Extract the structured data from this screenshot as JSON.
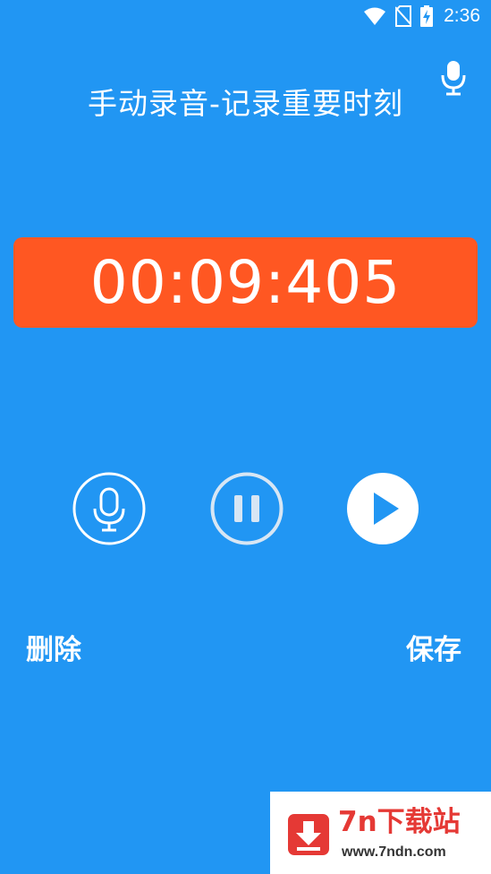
{
  "status_bar": {
    "time": "2:36",
    "icons": [
      "wifi-icon",
      "no-sim-icon",
      "battery-charging-icon"
    ]
  },
  "header": {
    "title": "手动录音-记录重要时刻",
    "icon": "microphone-icon"
  },
  "timer": {
    "value": "00:09:405",
    "color": "#FF5722"
  },
  "controls": {
    "record_icon": "microphone-icon",
    "pause_icon": "pause-icon",
    "play_icon": "play-icon"
  },
  "actions": {
    "delete_label": "删除",
    "save_label": "保存"
  },
  "watermark": {
    "title": "7n下载站",
    "url": "www.7ndn.com",
    "icon": "download-icon"
  },
  "colors": {
    "background": "#2196F3",
    "timer": "#FF5722",
    "watermark_accent": "#E53935"
  }
}
